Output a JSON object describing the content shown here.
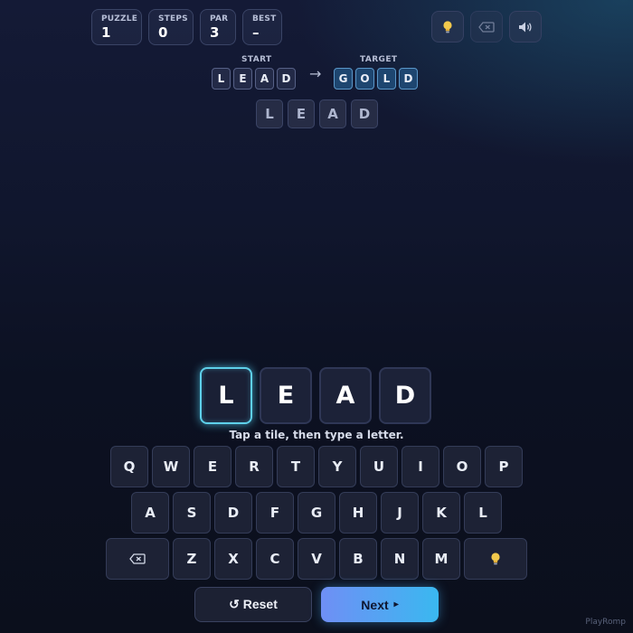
{
  "stats": {
    "puzzle": {
      "label": "PUZZLE",
      "value": "1"
    },
    "steps": {
      "label": "STEPS",
      "value": "0"
    },
    "par": {
      "label": "PAR",
      "value": "3"
    },
    "best": {
      "label": "BEST",
      "value": "–"
    }
  },
  "toolbar": {
    "hint_icon": "lightbulb-icon",
    "backspace_icon": "backspace-icon",
    "sound_icon": "speaker-icon"
  },
  "header": {
    "start_label": "START",
    "target_label": "TARGET",
    "arrow": "→",
    "start_letters": [
      "L",
      "E",
      "A",
      "D"
    ],
    "target_letters": [
      "G",
      "O",
      "L",
      "D"
    ]
  },
  "ladder": {
    "words": [
      [
        "L",
        "E",
        "A",
        "D"
      ]
    ]
  },
  "current": {
    "letters": [
      "L",
      "E",
      "A",
      "D"
    ],
    "active_index": 0,
    "hint_text": "Tap a tile, then type a letter."
  },
  "keyboard": {
    "row1": [
      "Q",
      "W",
      "E",
      "R",
      "T",
      "Y",
      "U",
      "I",
      "O",
      "P"
    ],
    "row2": [
      "A",
      "S",
      "D",
      "F",
      "G",
      "H",
      "J",
      "K",
      "L"
    ],
    "row3": [
      "Z",
      "X",
      "C",
      "V",
      "B",
      "N",
      "M"
    ],
    "backspace_icon": "backspace-icon",
    "hint_icon": "lightbulb-icon"
  },
  "buttons": {
    "reset_label": "↺ Reset",
    "next_label": "Next",
    "next_icon": "▸"
  },
  "brand": "PlayRomp",
  "colors": {
    "accent": "#3ab8f0",
    "active_tile_glow": "#5ed0ea",
    "target_tile": "#1e4670",
    "bulb": "#f2c94c"
  }
}
